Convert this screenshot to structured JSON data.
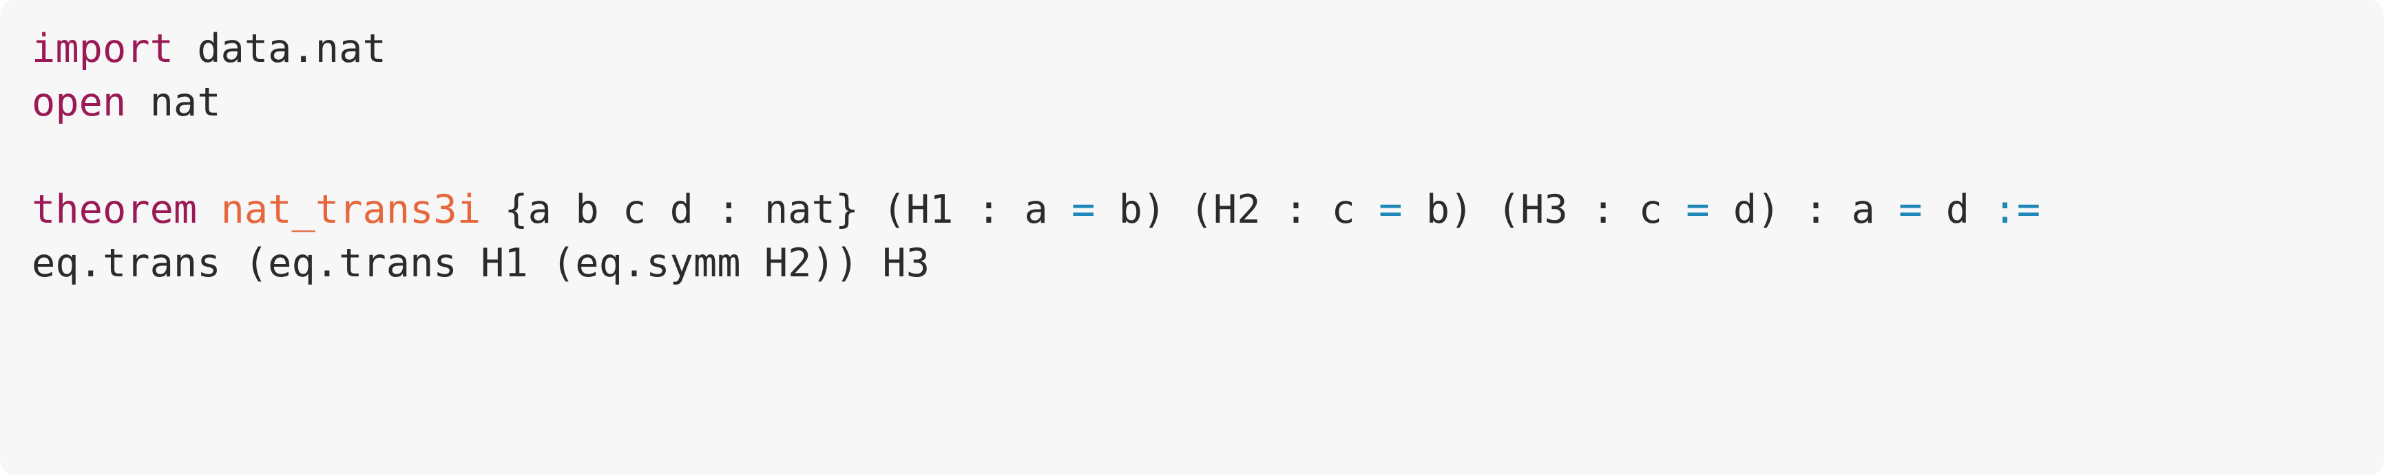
{
  "code": {
    "language": "lean",
    "lines": [
      {
        "tokens": [
          {
            "text": "import",
            "kind": "kw"
          },
          {
            "text": " data.nat",
            "kind": "pl"
          }
        ]
      },
      {
        "tokens": [
          {
            "text": "open",
            "kind": "kw"
          },
          {
            "text": " nat",
            "kind": "pl"
          }
        ]
      },
      {
        "tokens": []
      },
      {
        "tokens": [
          {
            "text": "theorem",
            "kind": "kw"
          },
          {
            "text": " ",
            "kind": "pl"
          },
          {
            "text": "nat_trans3i",
            "kind": "fn"
          },
          {
            "text": " {a b c d : nat} (H1 : a ",
            "kind": "pl"
          },
          {
            "text": "=",
            "kind": "op"
          },
          {
            "text": " b) (H2 : c ",
            "kind": "pl"
          },
          {
            "text": "=",
            "kind": "op"
          },
          {
            "text": " b) (H3 : c ",
            "kind": "pl"
          },
          {
            "text": "=",
            "kind": "op"
          },
          {
            "text": " d) : a ",
            "kind": "pl"
          },
          {
            "text": "=",
            "kind": "op"
          },
          {
            "text": " d ",
            "kind": "pl"
          },
          {
            "text": ":=",
            "kind": "op"
          }
        ]
      },
      {
        "tokens": [
          {
            "text": "eq.trans (eq.trans H1 (eq.symm H2)) H3",
            "kind": "pl"
          }
        ]
      }
    ]
  },
  "colors": {
    "background": "#f7f7f7",
    "keyword": "#9b1a56",
    "identifier": "#e6673e",
    "operator": "#1e86b8",
    "text": "#2b2b2b"
  }
}
